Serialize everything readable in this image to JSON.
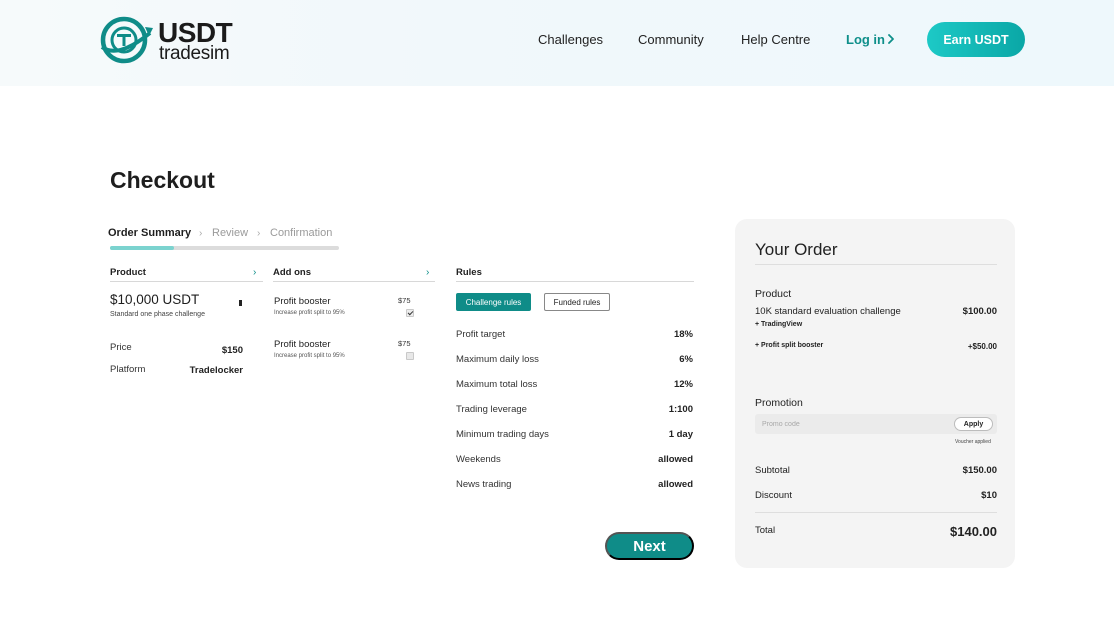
{
  "header": {
    "logo": {
      "line1": "USDT",
      "line2": "tradesim"
    },
    "nav": [
      "Challenges",
      "Community",
      "Help Centre"
    ],
    "login_label": "Log in",
    "cta_label": "Earn USDT",
    "brand_color": "#0f8c88"
  },
  "page": {
    "title": "Checkout",
    "steps": [
      "Order Summary",
      "Review",
      "Confirmation"
    ],
    "active_step": 0,
    "progress_fraction": 0.28
  },
  "product": {
    "header": "Product",
    "name": "$10,000 USDT",
    "description": "Standard one phase challenge",
    "price_label": "Price",
    "price_value": "$150",
    "platform_label": "Platform",
    "platform_value": "Tradelocker"
  },
  "addons": {
    "header": "Add ons",
    "items": [
      {
        "name": "Profit booster",
        "description": "Increase profit split to 95%",
        "price": "$75",
        "checked": true
      },
      {
        "name": "Profit booster",
        "description": "Increase profit split to 95%",
        "price": "$75",
        "checked": false
      }
    ]
  },
  "rules": {
    "header": "Rules",
    "tabs": [
      "Challenge rules",
      "Funded rules"
    ],
    "active_tab": 0,
    "rows": [
      {
        "label": "Profit target",
        "value": "18%"
      },
      {
        "label": "Maximum daily loss",
        "value": "6%"
      },
      {
        "label": "Maximum total loss",
        "value": "12%"
      },
      {
        "label": "Trading leverage",
        "value": "1:100"
      },
      {
        "label": "Minimum trading days",
        "value": "1 day"
      },
      {
        "label": "Weekends",
        "value": "allowed"
      },
      {
        "label": "News trading",
        "value": "allowed"
      }
    ]
  },
  "next_label": "Next",
  "order": {
    "title": "Your Order",
    "product_section": "Product",
    "item_name": "10K standard evaluation challenge",
    "item_price": "$100.00",
    "item_platform": "+ TradingView",
    "addon_name": "+ Profit split booster",
    "addon_price": "+$50.00",
    "promotion_section": "Promotion",
    "promo_placeholder": "Promo code",
    "apply_label": "Apply",
    "voucher_note": "Voucher applied",
    "subtotal_label": "Subtotal",
    "subtotal_value": "$150.00",
    "discount_label": "Discount",
    "discount_value": "$10",
    "total_label": "Total",
    "total_value": "$140.00"
  }
}
